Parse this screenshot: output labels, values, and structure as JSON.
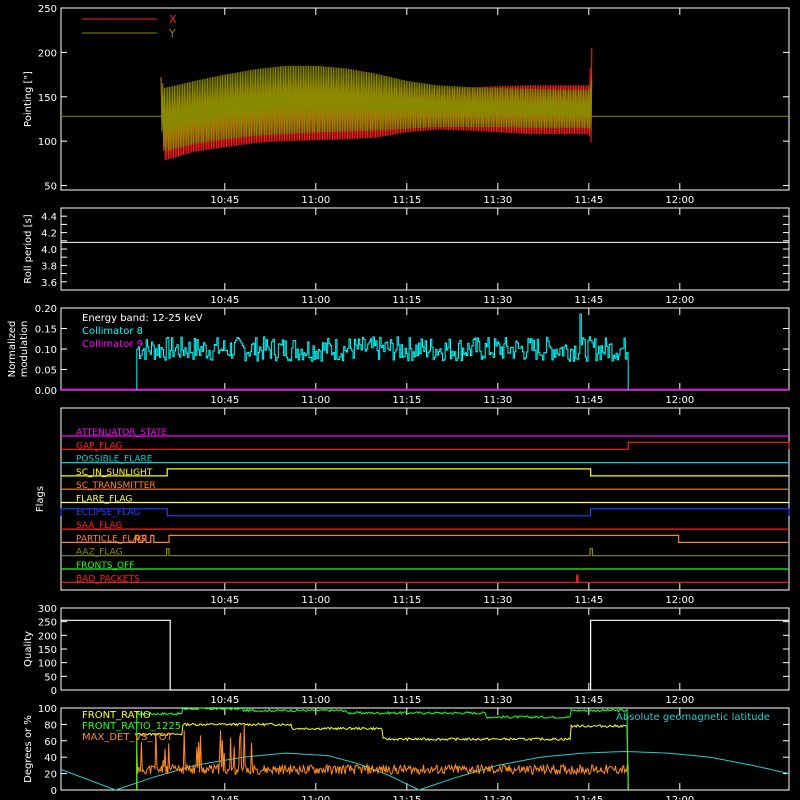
{
  "colors": {
    "background": "#000000",
    "axis": "#ffffff",
    "x_trace": "#ff2020",
    "y_trace": "#8a8a00",
    "roll": "#ffffff",
    "coll8": "#00ffff",
    "coll9": "#ff00ff",
    "quality": "#ffffff",
    "front_ratio": "#ffff20",
    "front_ratio_1225": "#20ff20",
    "max_det": "#ff8c20",
    "geomag": "#20d0d0"
  },
  "time_axis": {
    "start_min": 618,
    "end_min": 738,
    "ticks": [
      {
        "min": 645,
        "label": "10:45"
      },
      {
        "min": 660,
        "label": "11:00"
      },
      {
        "min": 675,
        "label": "11:15"
      },
      {
        "min": 690,
        "label": "11:30"
      },
      {
        "min": 705,
        "label": "11:45"
      },
      {
        "min": 720,
        "label": "12:00"
      }
    ]
  },
  "chart_data": [
    {
      "type": "line",
      "id": "pointing",
      "ylabel": "Pointing [\"]",
      "ylim": [
        45,
        250
      ],
      "yticks": [
        50,
        100,
        150,
        200,
        250
      ],
      "legend": [
        "X",
        "Y"
      ],
      "baseline": 128,
      "series": [
        {
          "name": "X",
          "x": [
            634.5,
            635,
            637,
            640,
            645,
            650,
            655,
            660,
            665,
            670,
            675,
            680,
            685,
            690,
            695,
            700,
            705,
            705.5
          ],
          "upper": [
            172,
            140,
            150,
            155,
            160,
            165,
            167,
            168,
            167,
            164,
            160,
            158,
            160,
            162,
            163,
            163,
            163,
            205
          ],
          "lower": [
            140,
            78,
            82,
            88,
            93,
            98,
            100,
            101,
            102,
            104,
            110,
            113,
            112,
            110,
            108,
            108,
            108,
            95
          ]
        },
        {
          "name": "Y",
          "x": [
            634.5,
            635,
            637,
            640,
            645,
            650,
            655,
            660,
            665,
            670,
            675,
            680,
            685,
            690,
            695,
            700,
            705,
            705.5
          ],
          "upper": [
            172,
            160,
            163,
            168,
            175,
            181,
            185,
            185,
            182,
            176,
            168,
            163,
            161,
            160,
            159,
            158,
            158,
            170
          ],
          "lower": [
            120,
            88,
            92,
            97,
            102,
            106,
            108,
            110,
            111,
            112,
            114,
            116,
            116,
            116,
            115,
            115,
            115,
            110
          ]
        }
      ]
    },
    {
      "type": "line",
      "id": "roll",
      "ylabel": "Roll period [s]",
      "ylim": [
        3.5,
        4.5
      ],
      "yticks": [
        3.6,
        3.7,
        3.8,
        3.9,
        4.0,
        4.1,
        4.2,
        4.3,
        4.4
      ],
      "yticklabels": [
        "3.6",
        "3.8",
        "4.0",
        "4.2",
        "4.4"
      ],
      "series": [
        {
          "name": "",
          "x": [
            618,
            738
          ],
          "values": [
            4.08,
            4.08
          ]
        }
      ]
    },
    {
      "type": "line",
      "id": "modulation",
      "ylabel_lines": [
        "Normalized",
        "modulation"
      ],
      "ylim": [
        0,
        0.2
      ],
      "yticks": [
        0.0,
        0.05,
        0.1,
        0.15,
        0.2
      ],
      "yticklabels": [
        "0.00",
        "0.05",
        "0.10",
        "0.15",
        "0.20"
      ],
      "annotation": "Energy band: 12-25 keV",
      "legend": [
        "Collimator 8",
        "Collimator 9"
      ],
      "series": [
        {
          "name": "Collimator 8",
          "x_start": 630.5,
          "x_end": 711.5,
          "mean": 0.1,
          "spread": 0.03,
          "spike": {
            "x": 703.5,
            "value": 0.185
          }
        },
        {
          "name": "Collimator 9",
          "x": [
            618,
            738
          ],
          "values": [
            0.0,
            0.0
          ]
        }
      ]
    },
    {
      "type": "line",
      "id": "flags",
      "ylabel": "Flags",
      "rows": [
        {
          "label": "ATTENUATOR_STATE",
          "color": "#ff00ff",
          "segments": []
        },
        {
          "label": "GAP_FLAG",
          "color": "#ff2020",
          "segments": [
            [
              711.5,
              738
            ]
          ]
        },
        {
          "label": "POSSIBLE_FLARE",
          "color": "#00d0d0",
          "segments": []
        },
        {
          "label": "SC_IN_SUNLIGHT",
          "color": "#ffff00",
          "segments": [
            [
              635.5,
              705.3
            ]
          ]
        },
        {
          "label": "SC_TRANSMITTER",
          "color": "#ff8030",
          "segments": []
        },
        {
          "label": "FLARE_FLAG",
          "color": "#ffff60",
          "segments": []
        },
        {
          "label": "ECLIPSE_FLAG",
          "color": "#2040ff",
          "segments": [
            [
              618,
              635.5
            ],
            [
              705.3,
              738
            ]
          ]
        },
        {
          "label": "SAA_FLAG",
          "color": "#ff2020",
          "segments": []
        },
        {
          "label": "PARTICLE_FLAG",
          "color": "#ff8030",
          "segments": [
            [
              630.3,
              630.8
            ],
            [
              631.5,
              632
            ],
            [
              632.8,
              633.3
            ],
            [
              635.8,
              719.8
            ]
          ]
        },
        {
          "label": "AAZ_FLAG",
          "color": "#8a8a00",
          "segments": [
            [
              635.4,
              635.8
            ],
            [
              705.2,
              705.6
            ]
          ]
        },
        {
          "label": "FRONTS_OFF",
          "color": "#20ff20",
          "segments": []
        },
        {
          "label": "BAD_PACKETS",
          "color": "#ff2020",
          "segments": [
            [
              703,
              703.2
            ]
          ]
        }
      ]
    },
    {
      "type": "line",
      "id": "quality",
      "ylabel": "Quality",
      "ylim": [
        0,
        300
      ],
      "yticks": [
        0,
        50,
        100,
        150,
        200,
        250,
        300
      ],
      "series": [
        {
          "name": "",
          "x": [
            618,
            636,
            636,
            705.3,
            705.3,
            738
          ],
          "values": [
            255,
            255,
            0,
            0,
            255,
            255
          ]
        }
      ]
    },
    {
      "type": "line",
      "id": "ratios",
      "ylabel": "Degrees or %",
      "ylim": [
        0,
        100
      ],
      "yticks": [
        0,
        20,
        40,
        60,
        80,
        100
      ],
      "legend": [
        "FRONT_RATIO",
        "FRONT_RATIO_1225",
        "MAX_DET_VS_TOT"
      ],
      "annotation": "Absolute geomagnetic latitude",
      "series": [
        {
          "name": "FRONT_RATIO",
          "x": [
            630.5,
            638,
            638,
            656,
            656,
            671,
            671,
            702,
            702,
            711.5
          ],
          "values": [
            68,
            68,
            80,
            80,
            75,
            75,
            62,
            62,
            78,
            78
          ]
        },
        {
          "name": "FRONT_RATIO_1225",
          "x": [
            630.5,
            638,
            638,
            648,
            648,
            665,
            665,
            688,
            688,
            702,
            702,
            711.5
          ],
          "values": [
            93,
            93,
            99,
            99,
            97,
            97,
            94,
            94,
            89,
            89,
            97,
            97
          ]
        },
        {
          "name": "MAX_DET_VS_TOT",
          "x_start": 630.5,
          "x_end": 711.5,
          "mean": 25,
          "spread": 6
        },
        {
          "name": "Absolute geomagnetic latitude",
          "x": [
            618,
            622,
            627,
            633,
            640,
            648,
            655,
            662,
            667,
            672,
            677,
            683,
            690,
            697,
            704,
            711,
            718,
            725,
            732,
            738
          ],
          "values": [
            25,
            14,
            0,
            15,
            30,
            40,
            45,
            42,
            32,
            18,
            0,
            15,
            30,
            40,
            45,
            47,
            45,
            40,
            30,
            20
          ]
        }
      ]
    }
  ]
}
